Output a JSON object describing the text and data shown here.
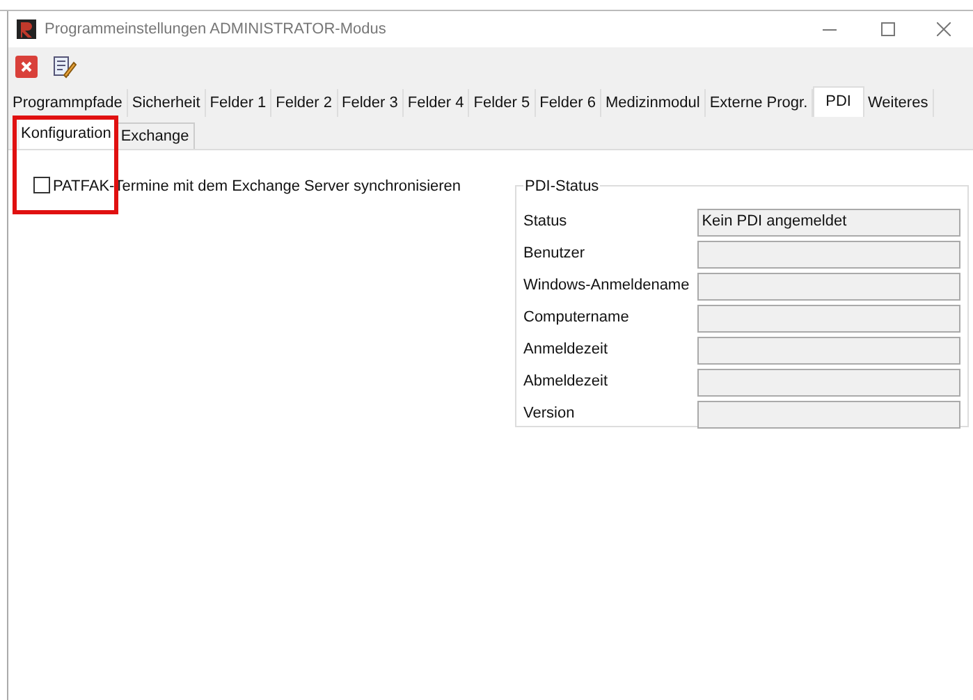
{
  "window": {
    "title": "Programmeinstellungen ADMINISTRATOR-Modus"
  },
  "tabs": [
    {
      "label": "Programmpfade",
      "selected": false
    },
    {
      "label": "Sicherheit",
      "selected": false
    },
    {
      "label": "Felder 1",
      "selected": false
    },
    {
      "label": "Felder 2",
      "selected": false
    },
    {
      "label": "Felder 3",
      "selected": false
    },
    {
      "label": "Felder 4",
      "selected": false
    },
    {
      "label": "Felder 5",
      "selected": false
    },
    {
      "label": "Felder 6",
      "selected": false
    },
    {
      "label": "Medizinmodul",
      "selected": false
    },
    {
      "label": "Externe Progr.",
      "selected": false
    },
    {
      "label": "PDI",
      "selected": true
    },
    {
      "label": "Weiteres",
      "selected": false
    }
  ],
  "subtabs": [
    {
      "label": "Konfiguration",
      "selected": true
    },
    {
      "label": "Exchange",
      "selected": false
    }
  ],
  "sync_checkbox": {
    "label": "PATFAK-Termine mit dem Exchange Server synchronisieren",
    "checked": false
  },
  "pdi_status": {
    "title": "PDI-Status",
    "fields": [
      {
        "label": "Status",
        "value": "Kein PDI angemeldet"
      },
      {
        "label": "Benutzer"
      },
      {
        "label": "Windows-Anmeldename"
      },
      {
        "label": "Computername"
      },
      {
        "label": "Anmeldezeit"
      },
      {
        "label": "Abmeldezeit"
      },
      {
        "label": "Version"
      }
    ]
  }
}
